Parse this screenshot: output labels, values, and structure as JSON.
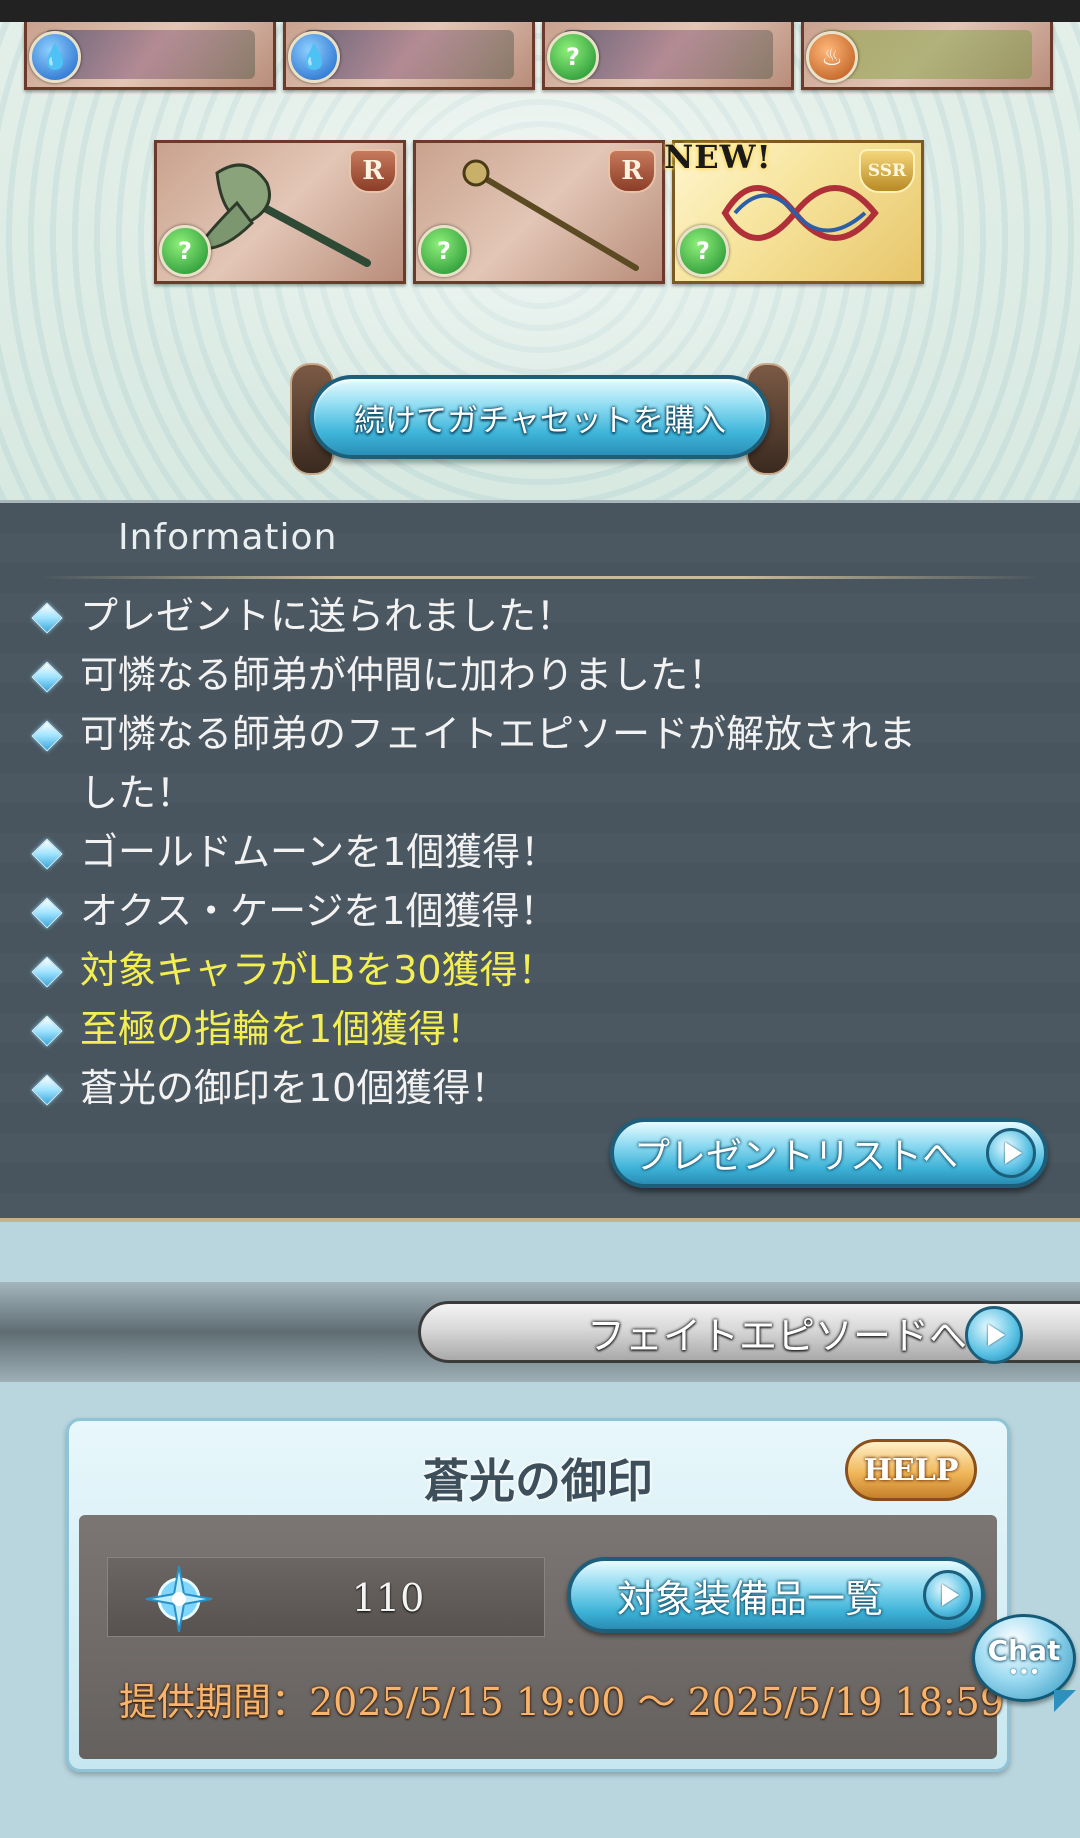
{
  "gacha": {
    "top_row": [
      {
        "element": "water"
      },
      {
        "element": "water"
      },
      {
        "element": "wind"
      },
      {
        "element": "fire"
      }
    ],
    "results": [
      {
        "type": "axe",
        "element": "wind",
        "rarity": "R",
        "is_new": false
      },
      {
        "type": "staff",
        "element": "wind",
        "rarity": "R",
        "is_new": false
      },
      {
        "type": "weapon",
        "element": "wind",
        "rarity": "SSR",
        "is_new": true
      }
    ],
    "new_badge": "NEW!",
    "buy_again_button": "続けてガチャセットを購入"
  },
  "information": {
    "title": "Information",
    "items": [
      {
        "text": "プレゼントに送られました！",
        "highlight": false
      },
      {
        "text": "可憐なる師弟が仲間に加わりました！",
        "highlight": false
      },
      {
        "text": "可憐なる師弟のフェイトエピソードが解放されました！",
        "highlight": false
      },
      {
        "text": "ゴールドムーンを1個獲得！",
        "highlight": false
      },
      {
        "text": "オクス・ケージを1個獲得！",
        "highlight": false
      },
      {
        "text": "対象キャラがLBを30獲得！",
        "highlight": true
      },
      {
        "text": "至極の指輪を1個獲得！",
        "highlight": true
      },
      {
        "text": "蒼光の御印を10個獲得！",
        "highlight": false
      }
    ],
    "present_list_button": "プレゼントリストへ"
  },
  "fate_episode_button": "フェイトエピソードへ",
  "seal": {
    "title": "蒼光の御印",
    "help_button": "HELP",
    "count": "110",
    "target_equipment_button": "対象装備品一覧",
    "period": "提供期間：2025/5/15 19:00 〜 2025/5/19 18:59"
  },
  "chat_button": "Chat",
  "colors": {
    "highlight_text": "#f3ee52",
    "button_blue": "#3db2d7",
    "panel_gray": "#48555e",
    "period_text": "#f7b46a"
  }
}
